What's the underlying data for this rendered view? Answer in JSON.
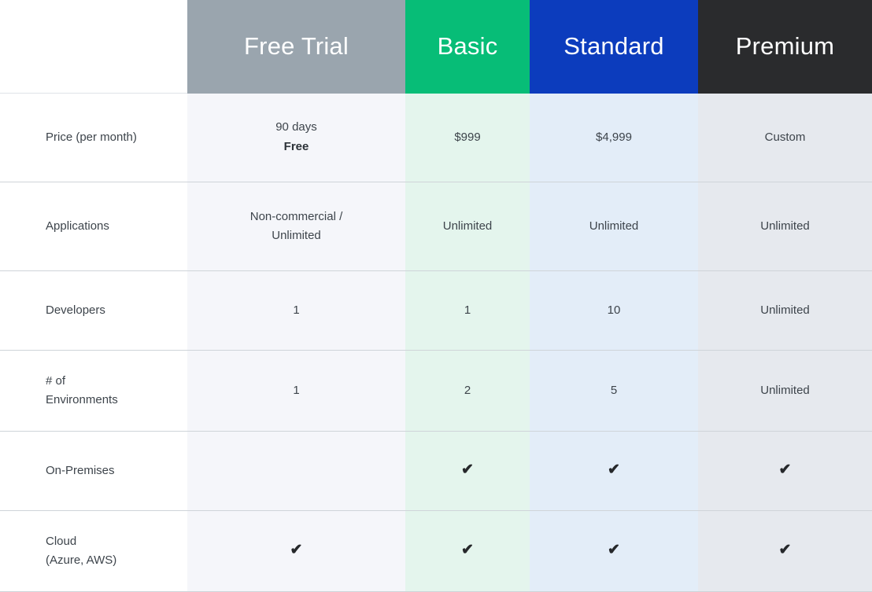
{
  "table": {
    "columns": [
      {
        "key": "feature",
        "label": "",
        "header_bg": "#ffffff",
        "body_bg": "#ffffff"
      },
      {
        "key": "free",
        "label": "Free Trial",
        "header_bg": "#9aa5ae",
        "body_bg": "#f5f6fa"
      },
      {
        "key": "basic",
        "label": "Basic",
        "header_bg": "#07bd77",
        "body_bg": "#e4f5ed"
      },
      {
        "key": "standard",
        "label": "Standard",
        "header_bg": "#0c3cbd",
        "body_bg": "#e3edf8"
      },
      {
        "key": "premium",
        "label": "Premium",
        "header_bg": "#2a2b2d",
        "body_bg": "#e6e9ee"
      }
    ],
    "rows": [
      {
        "feature": "Price (per month)",
        "free_line1": "90 days",
        "free_line2": "Free",
        "basic": "$999",
        "standard": "$4,999",
        "premium": "Custom"
      },
      {
        "feature": "Applications",
        "free_line1": "Non-commercial /",
        "free_line2": "Unlimited",
        "basic": "Unlimited",
        "standard": "Unlimited",
        "premium": "Unlimited"
      },
      {
        "feature": "Developers",
        "free": "1",
        "basic": "1",
        "standard": "10",
        "premium": "Unlimited"
      },
      {
        "feature_line1": "# of",
        "feature_line2": "Environments",
        "free": "1",
        "basic": "2",
        "standard": "5",
        "premium": "Unlimited"
      },
      {
        "feature": "On-Premises",
        "free": "",
        "basic": "✔",
        "standard": "✔",
        "premium": "✔"
      },
      {
        "feature_line1": "Cloud",
        "feature_line2": "(Azure, AWS)",
        "free": "✔",
        "basic": "✔",
        "standard": "✔",
        "premium": "✔"
      }
    ]
  }
}
